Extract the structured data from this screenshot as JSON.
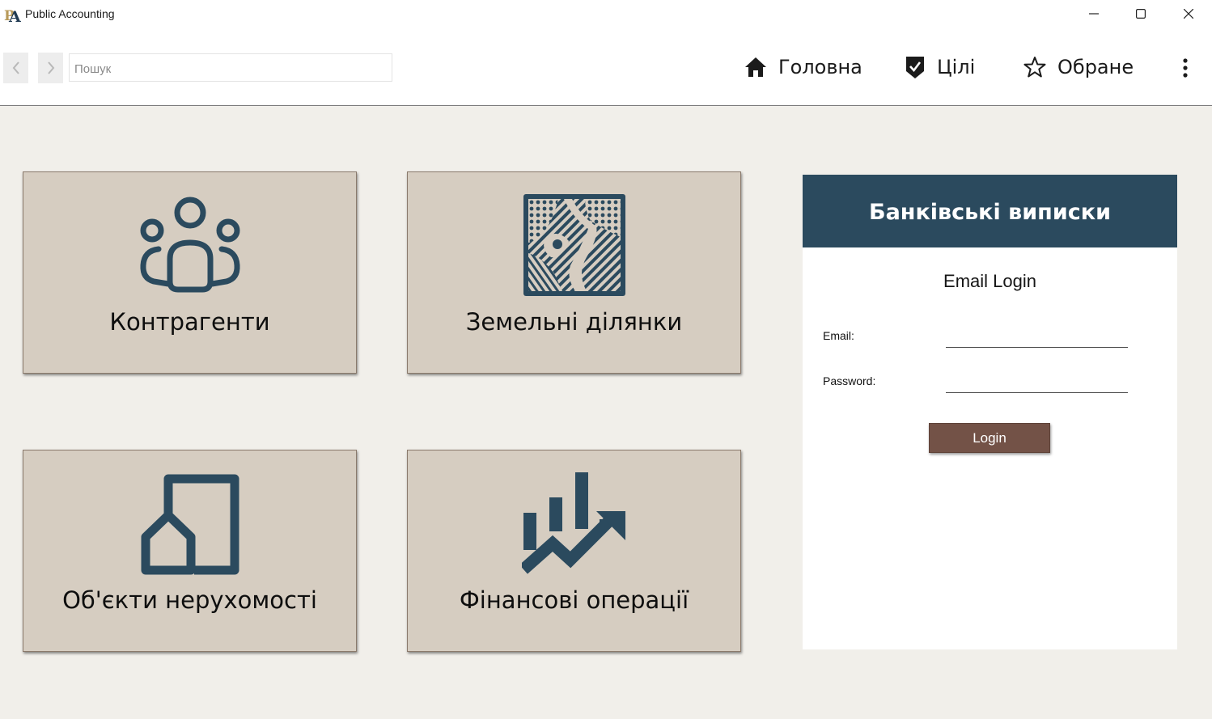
{
  "window": {
    "title": "Public Accounting",
    "minimize_icon": "minimize-icon",
    "maximize_icon": "maximize-icon",
    "close_icon": "close-icon"
  },
  "toolbar": {
    "back_icon": "chevron-left-icon",
    "forward_icon": "chevron-right-icon",
    "search_placeholder": "Пошук",
    "search_value": "",
    "nav": [
      {
        "label": "Головна",
        "icon": "home-icon"
      },
      {
        "label": "Цілі",
        "icon": "shield-check-icon"
      },
      {
        "label": "Обране",
        "icon": "star-outline-icon"
      }
    ],
    "more_icon": "more-vertical-icon"
  },
  "tiles": [
    {
      "label": "Контрагенти",
      "icon": "people-group-icon"
    },
    {
      "label": "Земельні ділянки",
      "icon": "land-plot-map-icon"
    },
    {
      "label": "Об'єкти нерухомості",
      "icon": "house-building-icon"
    },
    {
      "label": "Фінансові операції",
      "icon": "financial-chart-icon"
    }
  ],
  "bank_panel": {
    "title": "Банківські виписки",
    "login_title": "Email Login",
    "email_label": "Email:",
    "email_value": "",
    "password_label": "Password:",
    "password_value": "",
    "login_button": "Login"
  },
  "colors": {
    "accent_dark": "#2b4a5e",
    "tile_bg": "#d6cdc1",
    "page_bg": "#f1efea",
    "button_brown": "#735247"
  }
}
